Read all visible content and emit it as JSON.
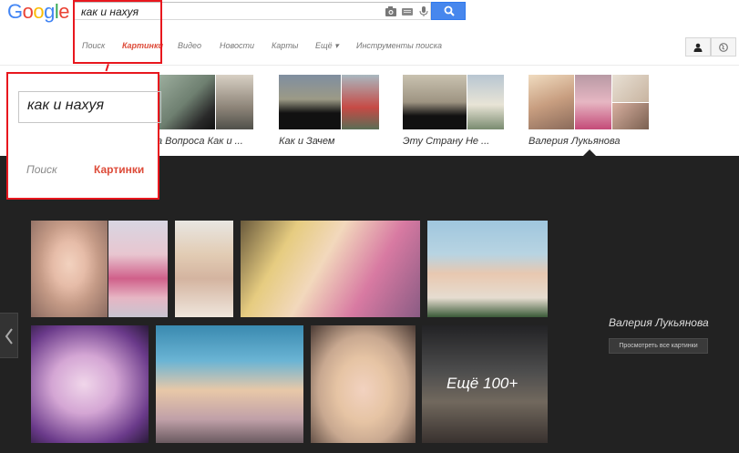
{
  "header": {
    "logo": "Google",
    "search": {
      "value": "как и нахуя"
    }
  },
  "nav": {
    "items": [
      {
        "label": "Поиск",
        "active": false
      },
      {
        "label": "Картинки",
        "active": true
      },
      {
        "label": "Видео",
        "active": false
      },
      {
        "label": "Новости",
        "active": false
      },
      {
        "label": "Карты",
        "active": false
      },
      {
        "label": "Ещё ▾",
        "active": false
      },
      {
        "label": "Инструменты поиска",
        "active": false
      }
    ]
  },
  "related": [
    {
      "label": "а Вопроса Как и ..."
    },
    {
      "label": "Как и Зачем"
    },
    {
      "label": "Эту Страну Не ..."
    },
    {
      "label": "Валерия Лукьянова"
    }
  ],
  "panel": {
    "title": "Валерия Лукьянова",
    "view_all": "Просмотреть все картинки",
    "more": "Ещё 100+"
  },
  "callout": {
    "query": "как и нахуя",
    "tab_search": "Поиск",
    "tab_images": "Картинки"
  },
  "colors": {
    "accent_red": "#dd4b39",
    "search_blue": "#4787ed",
    "panel_bg": "#222222",
    "callout_border": "#e8171e"
  }
}
